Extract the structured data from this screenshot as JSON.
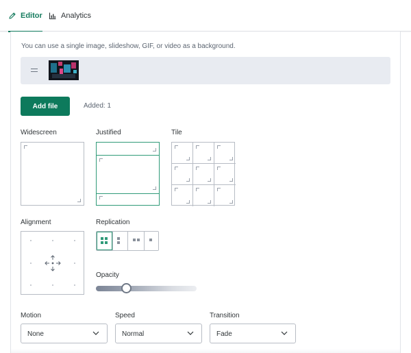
{
  "tabs": [
    {
      "label": "Editor",
      "icon": "pencil-icon",
      "active": true
    },
    {
      "label": "Analytics",
      "icon": "bar-chart-icon",
      "active": false
    }
  ],
  "background": {
    "hint": "You can use a single image, slideshow, GIF, or video as a background.",
    "add_file_label": "Add file",
    "added_text": "Added: 1"
  },
  "layout": {
    "options": [
      {
        "label": "Widescreen",
        "selected": false
      },
      {
        "label": "Justified",
        "selected": true
      },
      {
        "label": "Tile",
        "selected": false
      }
    ]
  },
  "alignment": {
    "label": "Alignment",
    "selected": "center"
  },
  "replication": {
    "label": "Replication",
    "selected_index": 0
  },
  "opacity": {
    "label": "Opacity",
    "value": 0.3
  },
  "motion": {
    "label": "Motion",
    "value": "None"
  },
  "speed": {
    "label": "Speed",
    "value": "Normal"
  },
  "transition": {
    "label": "Transition",
    "value": "Fade"
  },
  "colors": {
    "accent": "#0d7a5c",
    "selected_outline": "#2f9a78",
    "border": "#b7bcc4",
    "media_bg": "#e8ebf1"
  }
}
